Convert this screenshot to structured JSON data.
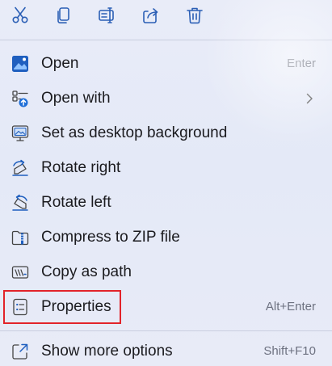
{
  "toolbar": {
    "buttons": [
      {
        "name": "cut",
        "icon": "scissors-icon"
      },
      {
        "name": "copy",
        "icon": "copy-icon"
      },
      {
        "name": "rename",
        "icon": "rename-icon"
      },
      {
        "name": "share",
        "icon": "share-icon"
      },
      {
        "name": "delete",
        "icon": "trash-icon"
      }
    ]
  },
  "items": [
    {
      "label": "Open",
      "shortcut": "Enter",
      "icon": "image-app-icon"
    },
    {
      "label": "Open with",
      "shortcut": "",
      "icon": "open-with-icon",
      "submenu": true
    },
    {
      "label": "Set as desktop background",
      "shortcut": "",
      "icon": "desktop-background-icon"
    },
    {
      "label": "Rotate right",
      "shortcut": "",
      "icon": "rotate-right-icon"
    },
    {
      "label": "Rotate left",
      "shortcut": "",
      "icon": "rotate-left-icon"
    },
    {
      "label": "Compress to ZIP file",
      "shortcut": "",
      "icon": "zip-icon"
    },
    {
      "label": "Copy as path",
      "shortcut": "",
      "icon": "copy-path-icon"
    },
    {
      "label": "Properties",
      "shortcut": "Alt+Enter",
      "icon": "properties-icon",
      "highlighted": true
    },
    {
      "label": "Show more options",
      "shortcut": "Shift+F10",
      "icon": "show-more-icon"
    }
  ],
  "colors": {
    "menu_background": "#e7ebf8",
    "icon_blue": "#1f5fbf",
    "highlight_border": "#e2232a",
    "shortcut_text": "#6d7180"
  }
}
